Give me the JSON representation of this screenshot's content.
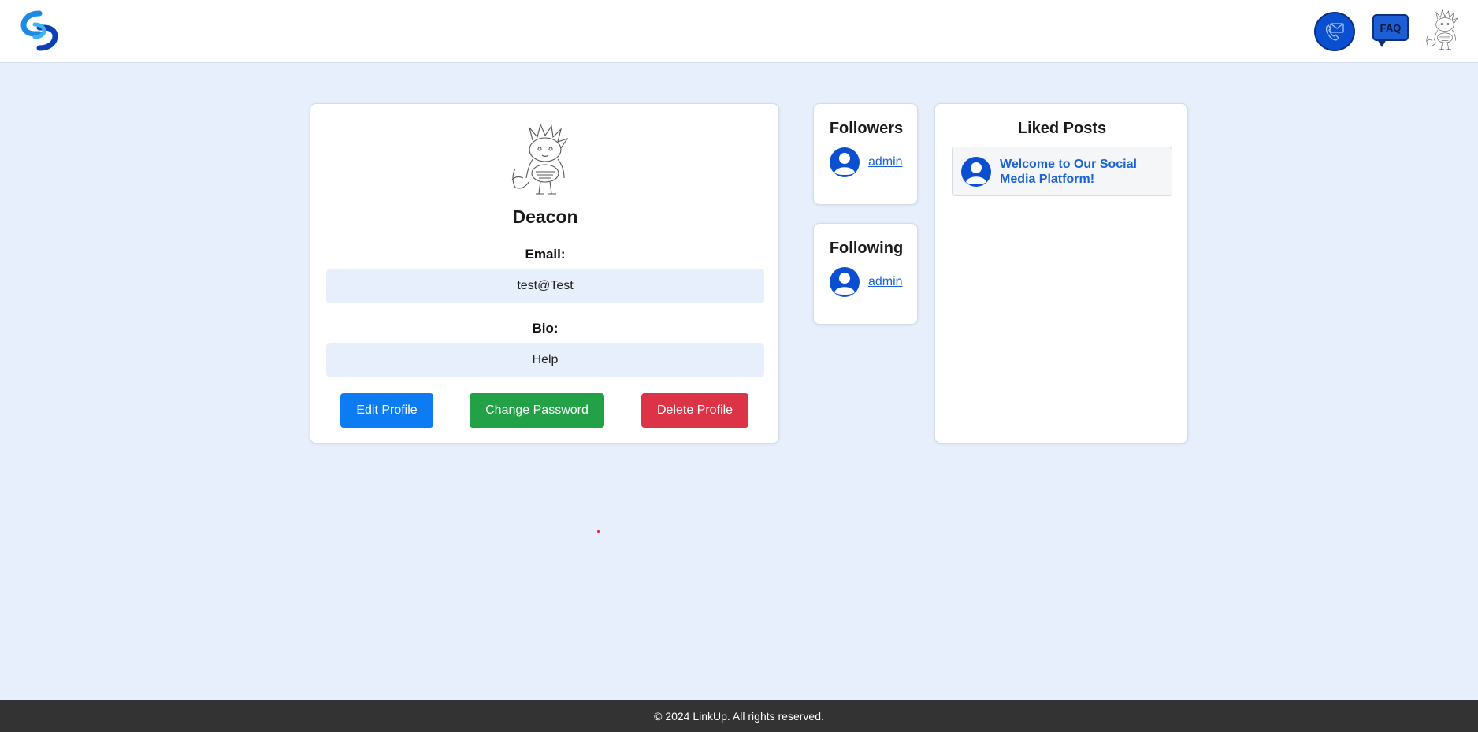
{
  "header": {
    "logo_icon": "linkup-logo-icon",
    "contact_icon": "phone-mail-icon",
    "faq_label": "FAQ",
    "avatar_icon": "user-avatar-illustration"
  },
  "profile": {
    "name": "Deacon",
    "email_label": "Email:",
    "email": "test@Test",
    "bio_label": "Bio:",
    "bio": "Help",
    "buttons": {
      "edit": "Edit Profile",
      "change_password": "Change Password",
      "delete": "Delete Profile"
    },
    "button_colors": {
      "edit": "#0d7cf2",
      "change_password": "#22a146",
      "delete": "#dc3346"
    }
  },
  "followers": {
    "title": "Followers",
    "users": [
      "admin"
    ]
  },
  "following": {
    "title": "Following",
    "users": [
      "admin"
    ]
  },
  "liked_posts": {
    "title": "Liked Posts",
    "posts": [
      "Welcome to Our Social Media Platform!"
    ]
  },
  "footer": {
    "text": "© 2024 LinkUp. All rights reserved."
  },
  "colors": {
    "background": "#e8effc",
    "brand": "#0a4fcf",
    "link": "#1a62d6",
    "footer": "#333333"
  }
}
